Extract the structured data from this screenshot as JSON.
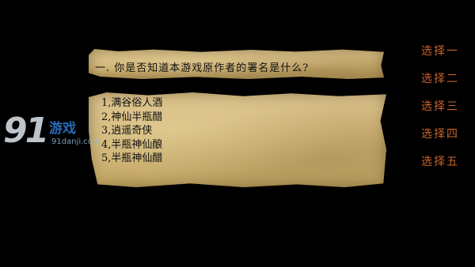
{
  "question": {
    "text": "一. 你是否知道本游戏原作者的署名是什么?"
  },
  "answers": [
    "1,满谷俗人酒",
    "2,神仙半瓶醋",
    "3,逍遥奇侠",
    "4,半瓶神仙酿",
    "5,半瓶神仙醋"
  ],
  "choices": [
    "选择一",
    "选择二",
    "选择三",
    "选择四",
    "选择五"
  ],
  "watermark": {
    "logo_number": "91",
    "logo_name": "游戏",
    "url": "91danji.com"
  },
  "colors": {
    "background": "#000000",
    "choice_text": "#c8642e",
    "parchment": "#cdb377"
  }
}
